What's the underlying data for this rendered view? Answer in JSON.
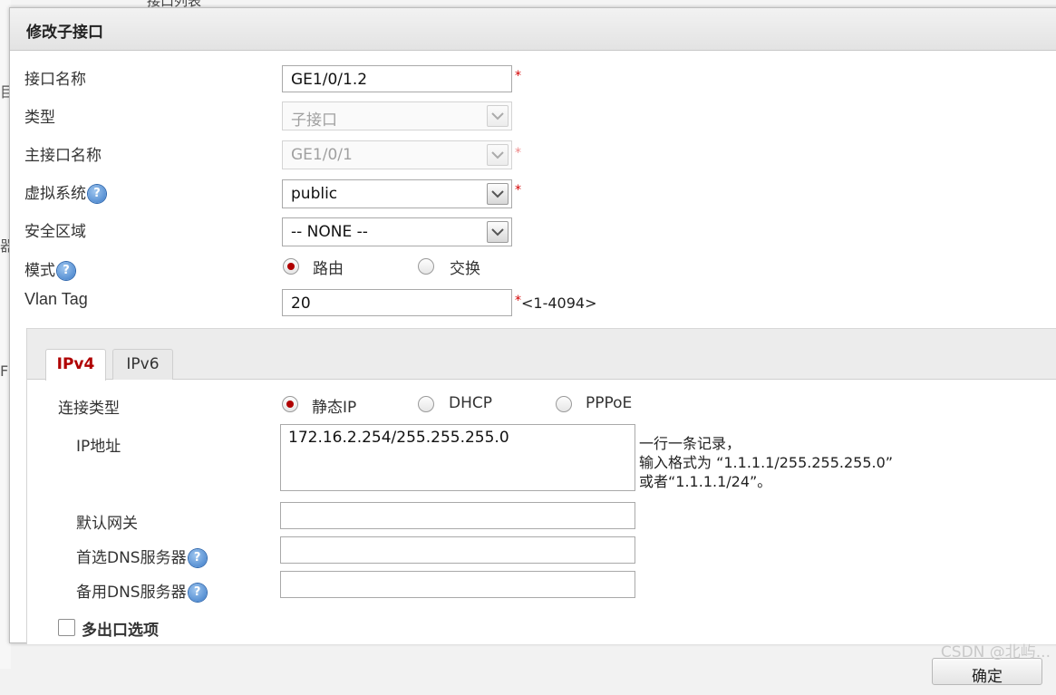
{
  "background": {
    "top_text": "接口列表",
    "left_fragments": [
      "目",
      "器",
      "F"
    ]
  },
  "dialog": {
    "title": "修改子接口"
  },
  "form": {
    "interface_name": {
      "label": "接口名称",
      "value": "GE1/0/1.2",
      "required_mark": "*"
    },
    "type": {
      "label": "类型",
      "value": "子接口"
    },
    "parent_interface": {
      "label": "主接口名称",
      "value": "GE1/0/1",
      "required_mark": "*"
    },
    "virtual_system": {
      "label": "虚拟系统",
      "value": "public",
      "required_mark": "*",
      "help": "?"
    },
    "security_zone": {
      "label": "安全区域",
      "value": "-- NONE --"
    },
    "mode": {
      "label": "模式",
      "help": "?",
      "options": [
        "路由",
        "交换"
      ],
      "selected": "路由"
    },
    "vlan_tag": {
      "label": "Vlan Tag",
      "value": "20",
      "required_mark": "*",
      "range_hint": "<1-4094>"
    }
  },
  "tabs": [
    {
      "label": "IPv4",
      "active": true
    },
    {
      "label": "IPv6",
      "active": false
    }
  ],
  "ipv4": {
    "connection_type": {
      "label": "连接类型",
      "options": [
        "静态IP",
        "DHCP",
        "PPPoE"
      ],
      "selected": "静态IP"
    },
    "ip_address": {
      "label": "IP地址",
      "value": "172.16.2.254/255.255.255.0",
      "hint_lines": [
        "一行一条记录，",
        "输入格式为 “1.1.1.1/255.255.255.0”",
        "或者“1.1.1.1/24”。"
      ]
    },
    "default_gateway": {
      "label": "默认网关",
      "value": ""
    },
    "primary_dns": {
      "label": "首选DNS服务器",
      "value": "",
      "help": "?"
    },
    "secondary_dns": {
      "label": "备用DNS服务器",
      "value": "",
      "help": "?"
    },
    "multi_egress": {
      "label": "多出口选项",
      "checked": false
    }
  },
  "footer": {
    "ok_label": "确定",
    "watermark": "CSDN @北屿..."
  },
  "colors": {
    "accent_red": "#b00000",
    "required_red": "#d40000",
    "help_blue": "#3b7bc8"
  }
}
